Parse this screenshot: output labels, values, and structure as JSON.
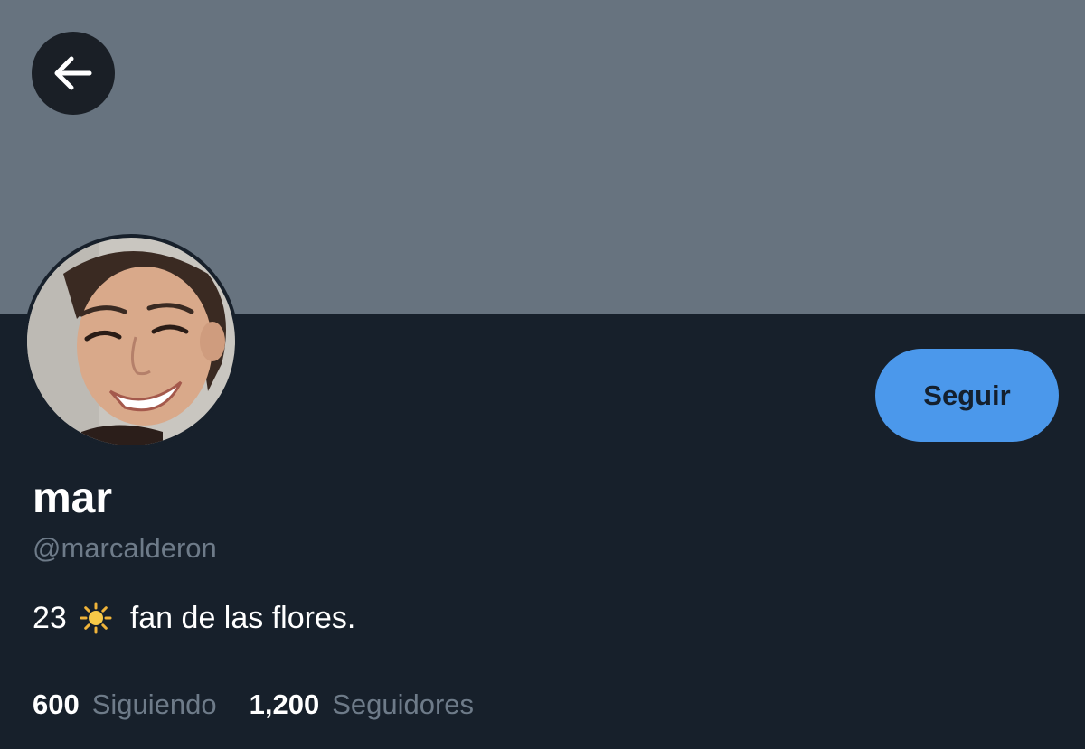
{
  "header": {
    "back_icon": "arrow-left-icon"
  },
  "profile": {
    "display_name": "mar",
    "handle": "@marcalderon",
    "bio_prefix": "23",
    "bio_emoji": "sun-icon",
    "bio_text": "fan de las flores.",
    "follow_label": "Seguir"
  },
  "stats": {
    "following_count": "600",
    "following_label": "Siguiendo",
    "followers_count": "1,200",
    "followers_label": "Seguidores"
  },
  "colors": {
    "banner": "#67737f",
    "background": "#17202b",
    "accent": "#4b98eb",
    "muted_text": "#6e7b89"
  }
}
